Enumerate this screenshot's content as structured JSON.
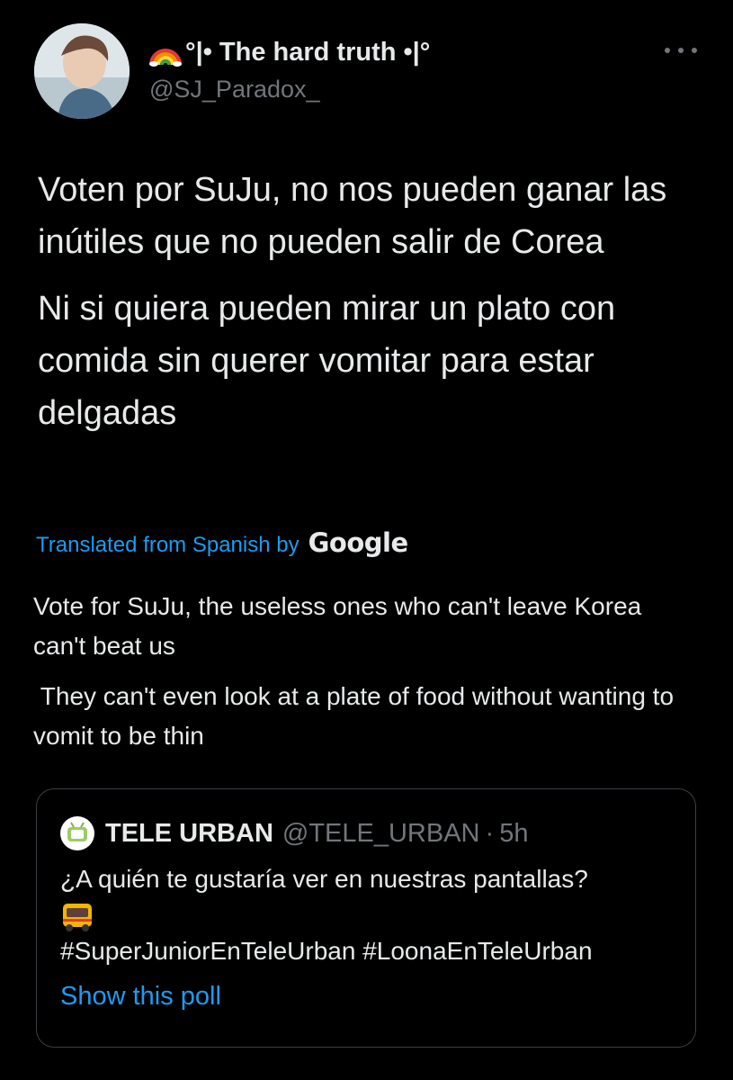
{
  "author": {
    "display_name": "°|• The hard truth •|°",
    "handle": "@SJ_Paradox_"
  },
  "tweet": {
    "original_paragraphs": [
      "Voten por SuJu, no nos pueden ganar las inútiles que no pueden salir de Corea",
      "Ni si quiera pueden mirar un plato con comida sin querer vomitar para estar delgadas"
    ],
    "translated_label": "Translated from Spanish by",
    "translator": "Google",
    "translation_paragraphs": [
      "Vote for SuJu, the useless ones who can't leave Korea can't beat us",
      " They can't even look at a plate of food without wanting to vomit to be thin"
    ]
  },
  "quoted_tweet": {
    "name": "TELE URBAN",
    "handle": "@TELE_URBAN",
    "separator": "·",
    "time": "5h",
    "text_line1": "¿A quién te gustaría ver en nuestras pantallas?",
    "hashtags": "#SuperJuniorEnTeleUrban #LoonaEnTeleUrban",
    "show_poll": "Show this poll"
  },
  "icons": {
    "avatar": "profile-photo",
    "rainbow": "rainbow-emoji",
    "more": "more-options-icon",
    "quote_avatar": "tele-urban-logo",
    "bus": "bus-emoji"
  },
  "colors": {
    "background": "#000000",
    "text": "#e7e9ea",
    "secondary": "#71767b",
    "link": "#1d9bf0",
    "border": "#3a3f45"
  }
}
